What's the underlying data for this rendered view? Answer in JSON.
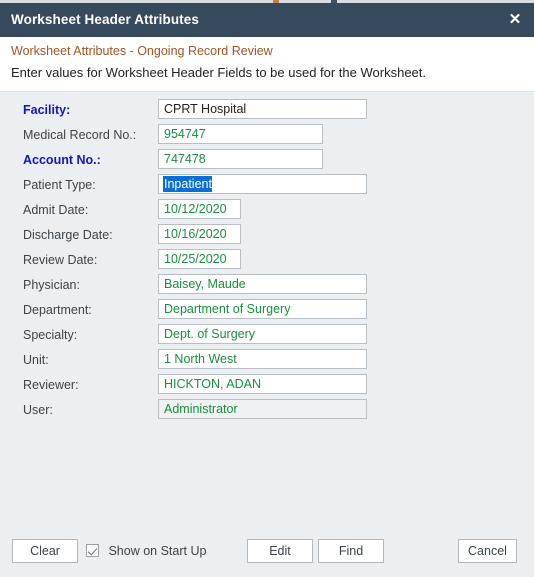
{
  "window": {
    "title": "Worksheet Header Attributes",
    "close_icon": "close-icon"
  },
  "intro": {
    "subtitle": "Worksheet Attributes - Ongoing Record Review",
    "instruction": "Enter values for Worksheet Header Fields to be used for the Worksheet."
  },
  "form": {
    "fields": [
      {
        "label": "Facility:",
        "value": "CPRT Hospital",
        "required": true,
        "width": "wide",
        "value_color": "dark",
        "readonly": false,
        "selected": false
      },
      {
        "label": "Medical Record No.:",
        "value": "954747",
        "required": false,
        "width": "med",
        "value_color": "green",
        "readonly": false,
        "selected": false
      },
      {
        "label": "Account No.:",
        "value": "747478",
        "required": true,
        "width": "med",
        "value_color": "green",
        "readonly": false,
        "selected": false
      },
      {
        "label": "Patient Type:",
        "value": "Inpatient",
        "required": false,
        "width": "wide",
        "value_color": "green",
        "readonly": false,
        "selected": true
      },
      {
        "label": "Admit Date:",
        "value": "10/12/2020",
        "required": false,
        "width": "narrow",
        "value_color": "green",
        "readonly": false,
        "selected": false
      },
      {
        "label": "Discharge Date:",
        "value": "10/16/2020",
        "required": false,
        "width": "narrow",
        "value_color": "green",
        "readonly": false,
        "selected": false
      },
      {
        "label": "Review Date:",
        "value": "10/25/2020",
        "required": false,
        "width": "narrow",
        "value_color": "green",
        "readonly": false,
        "selected": false
      },
      {
        "label": "Physician:",
        "value": "Baisey, Maude",
        "required": false,
        "width": "wide",
        "value_color": "green",
        "readonly": false,
        "selected": false
      },
      {
        "label": "Department:",
        "value": "Department of Surgery",
        "required": false,
        "width": "wide",
        "value_color": "green",
        "readonly": false,
        "selected": false
      },
      {
        "label": "Specialty:",
        "value": "Dept. of Surgery",
        "required": false,
        "width": "wide",
        "value_color": "green",
        "readonly": false,
        "selected": false
      },
      {
        "label": "Unit:",
        "value": "1 North West",
        "required": false,
        "width": "wide",
        "value_color": "green",
        "readonly": false,
        "selected": false
      },
      {
        "label": "Reviewer:",
        "value": "HICKTON, ADAN",
        "required": false,
        "width": "wide",
        "value_color": "green",
        "readonly": false,
        "selected": false
      },
      {
        "label": "User:",
        "value": "Administrator",
        "required": false,
        "width": "wide",
        "value_color": "green",
        "readonly": true,
        "selected": false
      }
    ]
  },
  "footer": {
    "clear_label": "Clear",
    "edit_label": "Edit",
    "find_label": "Find",
    "cancel_label": "Cancel",
    "checkbox_label": "Show on Start Up",
    "checkbox_checked": true
  },
  "colors": {
    "titlebar": "#37495c",
    "body": "#eceff1",
    "required_label": "#1414cc",
    "value_green": "#1a8f3c",
    "subtitle": "#a25525",
    "selection": "#0a6fd4"
  }
}
